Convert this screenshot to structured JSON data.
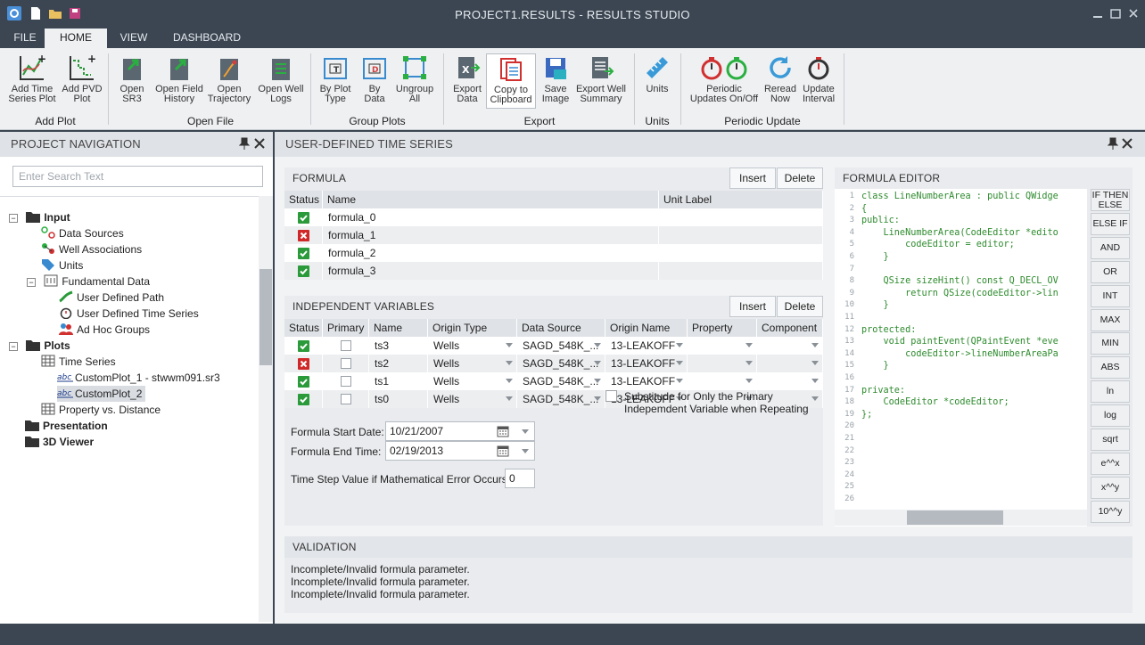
{
  "window": {
    "title": "PROJECT1.RESULTS - RESULTS STUDIO"
  },
  "menu": {
    "tabs": [
      "FILE",
      "HOME",
      "VIEW",
      "DASHBOARD"
    ],
    "active": "HOME"
  },
  "ribbon": {
    "groups": {
      "add_plot": "Add Plot",
      "open_file": "Open File",
      "group_plots": "Group Plots",
      "export": "Export",
      "units": "Units",
      "periodic_update": "Periodic Update"
    },
    "buttons": {
      "add_time_series_plot": [
        "Add Time",
        "Series Plot"
      ],
      "add_pvd_plot": [
        "Add PVD",
        "Plot"
      ],
      "open_sr3": [
        "Open",
        "SR3"
      ],
      "open_field_history": [
        "Open Field",
        "History"
      ],
      "open_trajectory": [
        "Open",
        "Trajectory"
      ],
      "open_well_logs": [
        "Open Well",
        "Logs"
      ],
      "by_plot_type": [
        "By Plot",
        "Type"
      ],
      "by_data": [
        "By",
        "Data"
      ],
      "ungroup_all": [
        "Ungroup",
        "All"
      ],
      "export_data": [
        "Export",
        "Data"
      ],
      "copy_to_clipboard": [
        "Copy to",
        "Clipboard"
      ],
      "save_image": [
        "Save",
        "Image"
      ],
      "export_well_summary": [
        "Export Well",
        "Summary"
      ],
      "units": [
        "Units",
        ""
      ],
      "periodic_updates": [
        "Periodic",
        "Updates On/Off"
      ],
      "reread_now": [
        "Reread",
        "Now"
      ],
      "update_interval": [
        "Update",
        "Interval"
      ]
    }
  },
  "nav": {
    "title": "PROJECT NAVIGATION",
    "search_placeholder": "Enter Search Text",
    "tree": {
      "input": "Input",
      "data_sources": "Data Sources",
      "well_associations": "Well Associations",
      "units": "Units",
      "fundamental_data": "Fundamental Data",
      "user_defined_path": "User Defined Path",
      "user_defined_time_series": "User Defined Time Series",
      "ad_hoc_groups": "Ad Hoc Groups",
      "plots": "Plots",
      "time_series": "Time Series",
      "customplot_1": "CustomPlot_1 - stwwm091.sr3",
      "customplot_2": "CustomPlot_2",
      "property_vs_distance": "Property vs. Distance",
      "presentation": "Presentation",
      "viewer_3d": "3D Viewer"
    }
  },
  "main": {
    "title": "USER-DEFINED TIME SERIES",
    "formula": {
      "title": "FORMULA",
      "insert": "Insert",
      "delete": "Delete",
      "columns": [
        "Status",
        "Name",
        "Unit Label"
      ],
      "rows": [
        {
          "status": "ok",
          "name": "formula_0",
          "unit": ""
        },
        {
          "status": "error",
          "name": "formula_1",
          "unit": ""
        },
        {
          "status": "ok",
          "name": "formula_2",
          "unit": ""
        },
        {
          "status": "ok",
          "name": "formula_3",
          "unit": ""
        }
      ]
    },
    "independent": {
      "title": "INDEPENDENT VARIABLES",
      "insert": "Insert",
      "delete": "Delete",
      "columns": [
        "Status",
        "Primary",
        "Name",
        "Origin Type",
        "Data Source",
        "Origin Name",
        "Property",
        "Component"
      ],
      "rows": [
        {
          "status": "ok",
          "name": "ts3",
          "origin_type": "Wells",
          "data_source": "SAGD_548K_...",
          "origin_name": "13-LEAKOFF"
        },
        {
          "status": "error",
          "name": "ts2",
          "origin_type": "Wells",
          "data_source": "SAGD_548K_...",
          "origin_name": "13-LEAKOFF"
        },
        {
          "status": "ok",
          "name": "ts1",
          "origin_type": "Wells",
          "data_source": "SAGD_548K_...",
          "origin_name": "13-LEAKOFF"
        },
        {
          "status": "ok",
          "name": "ts0",
          "origin_type": "Wells",
          "data_source": "SAGD_548K_...",
          "origin_name": "13-LEAKOFF"
        }
      ],
      "start_label": "Formula Start Date:",
      "start_value": "10/21/2007",
      "end_label": "Formula End Time:",
      "end_value": "02/19/2013",
      "timestep_label": "Time Step Value if Mathematical Error Occurs:",
      "timestep_value": "0",
      "substitute_label_1": "Substitude for Only the Primary",
      "substitute_label_2": "Indepemdent Variable when Repeating"
    },
    "editor": {
      "title": "FORMULA EDITOR",
      "lines": [
        "class LineNumberArea : public QWidge",
        "{",
        "public:",
        "    LineNumberArea(CodeEditor *edito",
        "        codeEditor = editor;",
        "    }",
        "",
        "    QSize sizeHint() const Q_DECL_OV",
        "        return QSize(codeEditor->lin",
        "    }",
        "",
        "protected:",
        "    void paintEvent(QPaintEvent *eve",
        "        codeEditor->lineNumberAreaPa",
        "    }",
        "",
        "private:",
        "    CodeEditor *codeEditor;",
        "};",
        "",
        "",
        "",
        "",
        "",
        "",
        ""
      ],
      "functions": [
        "IF THEN ELSE",
        "ELSE IF",
        "AND",
        "OR",
        "INT",
        "MAX",
        "MIN",
        "ABS",
        "ln",
        "log",
        "sqrt",
        "e^^x",
        "x^^y",
        "10^^y"
      ]
    },
    "validation": {
      "title": "VALIDATION",
      "messages": [
        "Incomplete/Invalid formula parameter.",
        "Incomplete/Invalid formula parameter.",
        "Incomplete/Invalid formula parameter."
      ]
    }
  }
}
